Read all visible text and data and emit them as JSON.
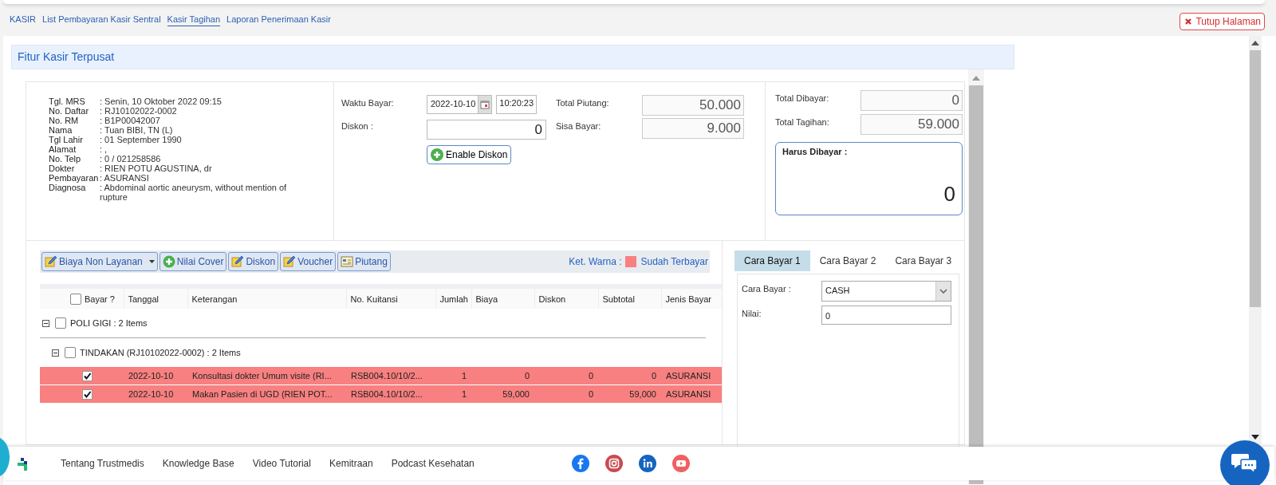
{
  "nav": {
    "links": [
      {
        "label": "KASIR",
        "selected": false
      },
      {
        "label": "List Pembayaran Kasir Sentral",
        "selected": false
      },
      {
        "label": "Kasir Tagihan",
        "selected": true
      },
      {
        "label": "Laporan Penerimaan Kasir",
        "selected": false
      }
    ],
    "close_button": {
      "label": "Tutup Halaman"
    }
  },
  "panel": {
    "title": "Fitur Kasir Terpusat"
  },
  "patient_info": [
    {
      "label": "Tgl. MRS",
      "value": ": Senin, 10 Oktober 2022 09:15"
    },
    {
      "label": "No. Daftar",
      "value": ": RJ10102022-0002"
    },
    {
      "label": "No. RM",
      "value": ": B1P00042007"
    },
    {
      "label": "Nama",
      "value": ": Tuan BIBI, TN (L)"
    },
    {
      "label": "Tgl Lahir",
      "value": ": 01 September 1990"
    },
    {
      "label": "Alamat",
      "value": ": ,"
    },
    {
      "label": "No. Telp",
      "value": ": 0 / 021258586"
    },
    {
      "label": "Dokter",
      "value": ": RIEN POTU AGUSTINA, dr"
    },
    {
      "label": "Pembayaran",
      "value": ": ASURANSI"
    },
    {
      "label": "Diagnosa",
      "value": ": Abdominal aortic aneurysm, without mention of rupture"
    }
  ],
  "payment": {
    "waktu_bayar": {
      "label": "Waktu Bayar:",
      "date": "2022-10-10",
      "time": "10:20:23"
    },
    "diskon": {
      "label": "Diskon :",
      "value": "0"
    },
    "enable_diskon_button": "Enable Diskon",
    "total_piutang": {
      "label": "Total Piutang:",
      "value": "50.000"
    },
    "sisa_bayar": {
      "label": "Sisa Bayar:",
      "value": "9.000"
    },
    "total_dibayar": {
      "label": "Total Dibayar:",
      "value": "0"
    },
    "total_tagihan": {
      "label": "Total Tagihan:",
      "value": "59.000"
    },
    "harus_dibayar": {
      "label": "Harus Dibayar :",
      "value": "0"
    }
  },
  "toolbar": {
    "buttons": [
      {
        "label": "Biaya Non Layanan",
        "kind": "edit",
        "dropdown": true
      },
      {
        "label": "Nilai Cover",
        "kind": "plus",
        "dropdown": false
      },
      {
        "label": "Diskon",
        "kind": "edit",
        "dropdown": false
      },
      {
        "label": "Voucher",
        "kind": "edit",
        "dropdown": false
      },
      {
        "label": "Piutang",
        "kind": "card",
        "dropdown": false
      }
    ],
    "legend": {
      "label": "Ket. Warna :",
      "color": "#f88080",
      "text": "Sudah Terbayar"
    }
  },
  "grid": {
    "select_all": {
      "label": "Bayar ?",
      "checked": false
    },
    "columns": [
      "Tanggal",
      "Keterangan",
      "No. Kuitansi",
      "Jumlah",
      "Biaya",
      "Diskon",
      "Subtotal",
      "Jenis Bayar"
    ],
    "groups": [
      {
        "label": "POLI GIGI : 2 Items",
        "expanded": true,
        "checked": false,
        "children": [
          {
            "label": "TINDAKAN (RJ10102022-0002) : 2 Items",
            "expanded": true,
            "checked": false,
            "rows": [
              {
                "checked": true,
                "paid": true,
                "cells": [
                  "2022-10-10",
                  "Konsultasi dokter Umum visite (RI...",
                  "RSB004.10/10/2...",
                  "1",
                  "0",
                  "0",
                  "0",
                  "ASURANSI"
                ]
              },
              {
                "checked": true,
                "paid": true,
                "cells": [
                  "2022-10-10",
                  "Makan Pasien di UGD (RIEN POT...",
                  "RSB004.10/10/2...",
                  "1",
                  "59,000",
                  "0",
                  "59,000",
                  "ASURANSI"
                ]
              }
            ]
          }
        ]
      }
    ]
  },
  "payment_methods": {
    "tabs": [
      {
        "label": "Cara Bayar 1",
        "selected": true
      },
      {
        "label": "Cara Bayar 2",
        "selected": false
      },
      {
        "label": "Cara Bayar 3",
        "selected": false
      }
    ],
    "method": {
      "label": "Cara Bayar :",
      "value": "CASH"
    },
    "amount": {
      "label": "Nilai:",
      "value": "0"
    }
  },
  "footer": {
    "links": [
      "Tentang Trustmedis",
      "Knowledge Base",
      "Video Tutorial",
      "Kemitraan",
      "Podcast Kesehatan"
    ],
    "social": [
      {
        "kind": "facebook"
      },
      {
        "kind": "instagram"
      },
      {
        "kind": "linkedin"
      },
      {
        "kind": "youtube"
      }
    ]
  }
}
